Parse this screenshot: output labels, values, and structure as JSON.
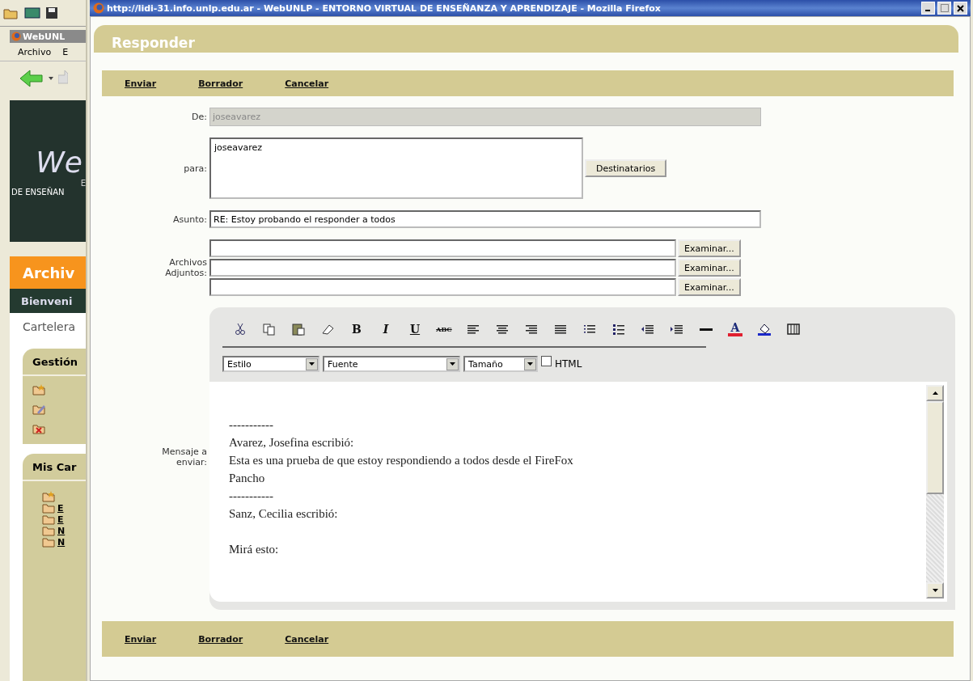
{
  "background_window": {
    "tab_title": "WebUNL",
    "menu": [
      "Archivo",
      "E"
    ],
    "banner_logo": "We",
    "banner_letter": "E",
    "banner_subtitle": "DE ENSEÑAN",
    "section_title": "Archiv",
    "welcome": "Bienveni",
    "nav_item": "Cartelera",
    "panels": [
      {
        "title": "Gestión"
      },
      {
        "title": "Mis Car"
      }
    ],
    "tree_items": [
      "E",
      "E",
      "N",
      "N"
    ]
  },
  "window": {
    "title": "http://lidi-31.info.unlp.edu.ar - WebUNLP - ENTORNO VIRTUAL DE ENSEÑANZA Y APRENDIZAJE - Mozilla Firefox"
  },
  "header": {
    "title": "Responder"
  },
  "top_actions": [
    "Enviar",
    "Borrador",
    "Cancelar"
  ],
  "form": {
    "from": {
      "label": "De:",
      "value": "joseavarez",
      "disabled": true
    },
    "to": {
      "label": "para:",
      "value": "joseavarez",
      "button": "Destinatarios"
    },
    "subject": {
      "label": "Asunto:",
      "value": "RE: Estoy probando el responder a todos"
    },
    "attachments": {
      "label": "Archivos Adjuntos:",
      "buttons": [
        "Examinar...",
        "Examinar...",
        "Examinar..."
      ]
    },
    "message": {
      "label": "Mensaje a enviar:",
      "glyphs": [
        "B",
        "I",
        "U",
        "ABC",
        "A"
      ],
      "selects": [
        "Estilo",
        "Fuente",
        "Tamaño"
      ],
      "html": {
        "label": "HTML",
        "checked": false
      },
      "paragraphs": [
        [
          "-----------",
          "Avarez, Josefina escribió:",
          "Esta es una prueba de que estoy respondiendo a todos desde el FireFox",
          "Pancho",
          "-----------",
          "Sanz, Cecilia escribió:"
        ],
        [
          "Mirá esto:"
        ]
      ]
    }
  },
  "bottom_actions": [
    "Enviar",
    "Borrador",
    "Cancelar"
  ]
}
